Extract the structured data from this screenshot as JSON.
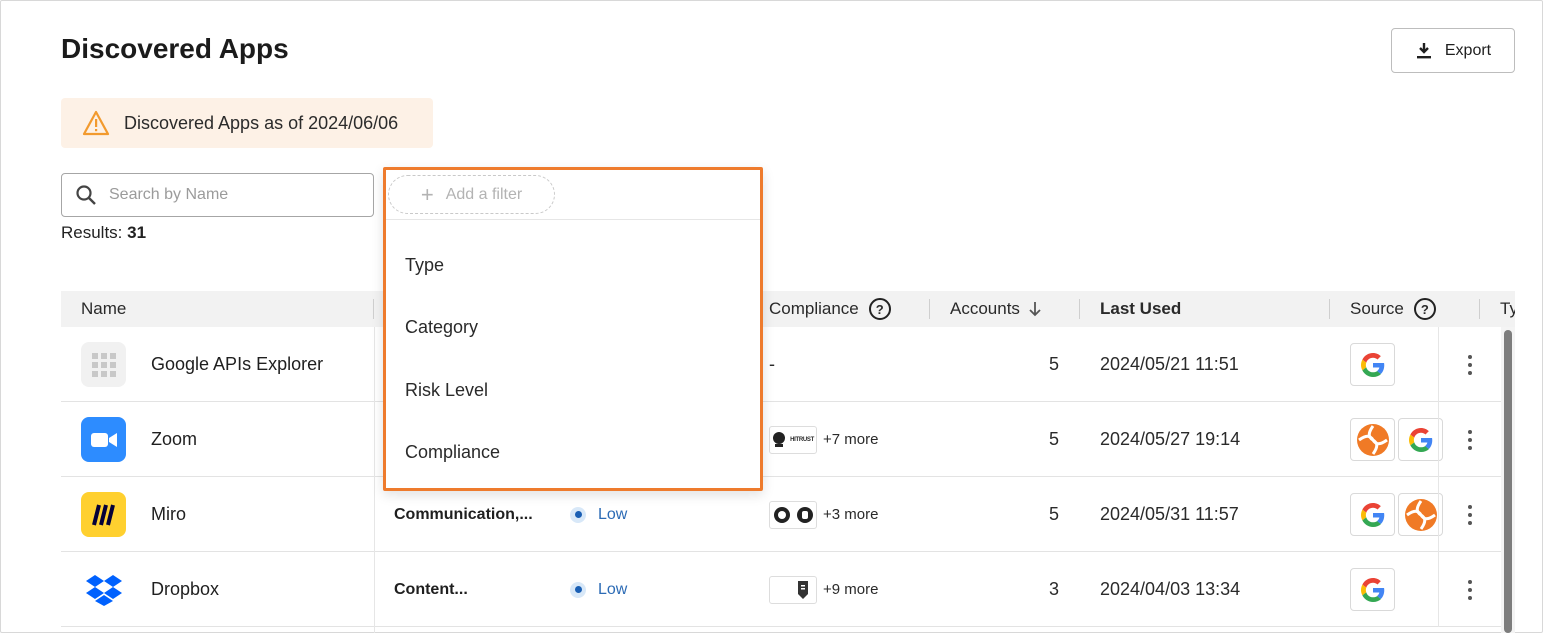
{
  "header": {
    "title": "Discovered Apps",
    "export_label": "Export"
  },
  "banner": {
    "text": "Discovered Apps as of 2024/06/06"
  },
  "search": {
    "placeholder": "Search by Name"
  },
  "results": {
    "label": "Results:",
    "count": "31"
  },
  "filter": {
    "add_label": "Add a filter",
    "options": [
      "Type",
      "Category",
      "Risk Level",
      "Compliance"
    ]
  },
  "table": {
    "columns": {
      "name": "Name",
      "compliance": "Compliance",
      "accounts": "Accounts",
      "last_used": "Last Used",
      "source": "Source",
      "type": "Ty"
    },
    "rows": [
      {
        "name": "Google APIs Explorer",
        "category": "",
        "risk": "",
        "compliance": "-",
        "more": "",
        "accounts": "5",
        "last_used": "2024/05/21 11:51"
      },
      {
        "name": "Zoom",
        "category": "",
        "risk": "",
        "compliance": "",
        "more": "+7 more",
        "accounts": "5",
        "last_used": "2024/05/27 19:14"
      },
      {
        "name": "Miro",
        "category": "Communication,...",
        "risk": "Low",
        "compliance": "",
        "more": "+3 more",
        "accounts": "5",
        "last_used": "2024/05/31 11:57"
      },
      {
        "name": "Dropbox",
        "category": "Content...",
        "risk": "Low",
        "compliance": "",
        "more": "+9 more",
        "accounts": "3",
        "last_used": "2024/04/03 13:34"
      }
    ]
  },
  "badge_text": {
    "hitrust": "HITRUST"
  },
  "colors": {
    "accent_orange": "#ee7b2d",
    "banner_bg": "#fdf1e6",
    "risk_low": "#2c6bb5",
    "zoom_blue": "#2d8cff",
    "miro_yellow": "#ffd02f",
    "dropbox_blue": "#0061fe"
  }
}
